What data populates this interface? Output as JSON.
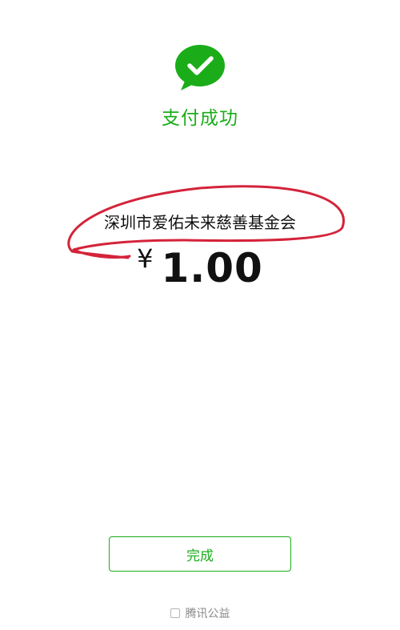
{
  "status": {
    "title": "支付成功",
    "icon": "check-circle-bubble-icon",
    "accent_color": "#1aad19"
  },
  "payment": {
    "merchant": "深圳市爱佑未来慈善基金会",
    "currency_symbol": "¥",
    "amount": "1.00"
  },
  "annotation": {
    "color": "#d4233a"
  },
  "actions": {
    "done_label": "完成"
  },
  "footer": {
    "checkbox_label": "腾讯公益",
    "checked": false
  }
}
